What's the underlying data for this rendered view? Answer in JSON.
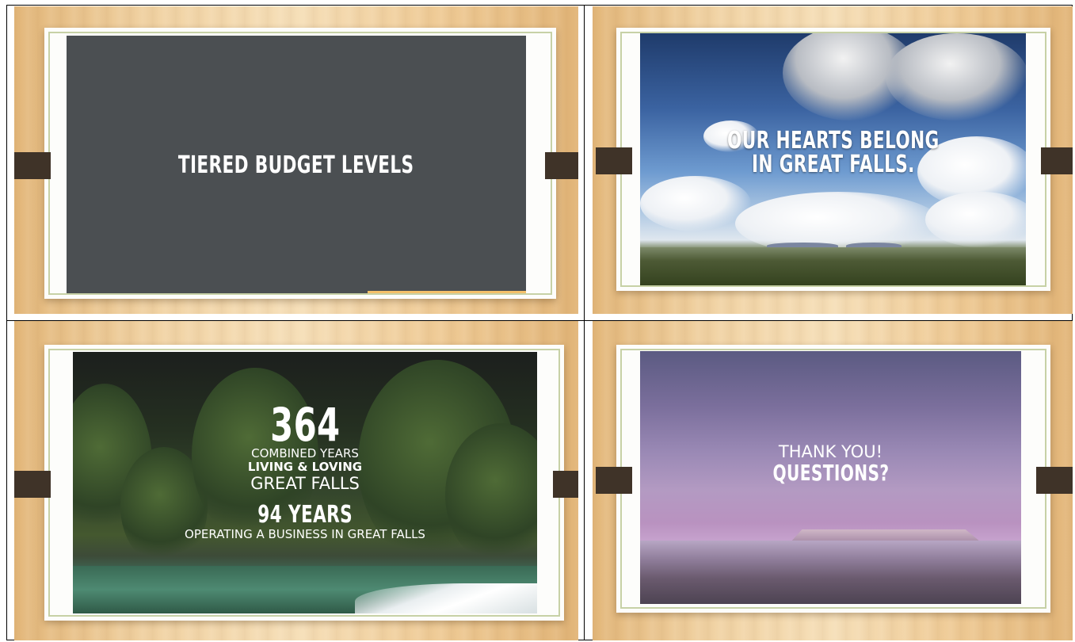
{
  "slides": [
    {
      "title": "TIERED BUDGET LEVELS"
    },
    {
      "line1": "OUR HEARTS BELONG",
      "line2": "IN GREAT FALLS."
    },
    {
      "big_number": "364",
      "line1": "COMBINED YEARS",
      "line2": "LIVING & LOVING",
      "line3": "GREAT FALLS",
      "years": "94 YEARS",
      "line4": "OPERATING A BUSINESS IN GREAT FALLS"
    },
    {
      "line1": "THANK YOU!",
      "line2": "QUESTIONS?"
    }
  ],
  "colors": {
    "slide1_background": "#4b4f52",
    "slide1_accent": "#f4c06a",
    "tab": "#3f3328",
    "frame_border": "#c7d1a6"
  }
}
